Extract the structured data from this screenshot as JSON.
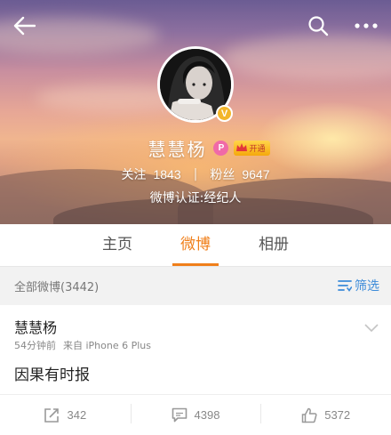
{
  "header": {
    "back_icon": "back-arrow-icon",
    "search_icon": "search-icon",
    "more_icon": "more-dots-icon"
  },
  "profile": {
    "name": "慧慧杨",
    "verified_badge": "V",
    "level_badge": "P",
    "vip_label": "开通",
    "following_label": "关注",
    "following_count": "1843",
    "separator": "|",
    "followers_label": "粉丝",
    "followers_count": "9647",
    "verification": "微博认证:经纪人"
  },
  "tabs": [
    {
      "label": "主页",
      "active": false
    },
    {
      "label": "微博",
      "active": true
    },
    {
      "label": "相册",
      "active": false
    }
  ],
  "filter_bar": {
    "all_posts": "全部微博(3442)",
    "filter_label": "筛选"
  },
  "post": {
    "author": "慧慧杨",
    "time": "54分钟前",
    "source": "来自 iPhone 6 Plus",
    "text": "因果有时报",
    "reposts": "342",
    "comments": "4398",
    "likes": "5372"
  },
  "colors": {
    "accent": "#f07f1a",
    "link": "#3c8bd9",
    "verified": "#f3b62a"
  }
}
